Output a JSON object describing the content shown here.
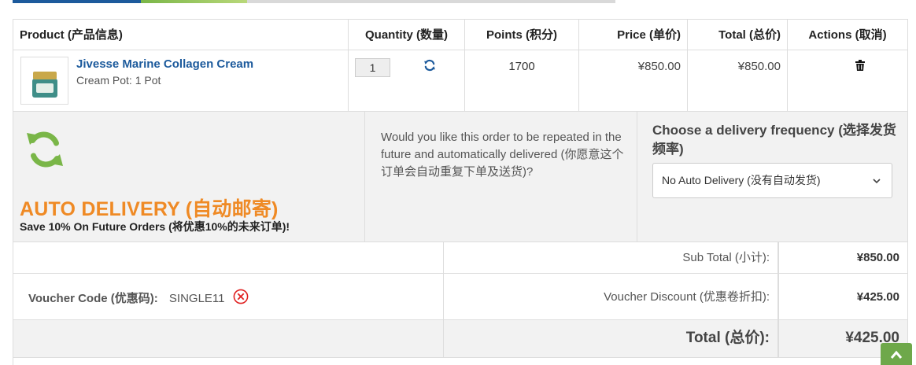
{
  "table": {
    "headers": {
      "product": "Product (产品信息)",
      "quantity": "Quantity (数量)",
      "points": "Points (积分)",
      "price": "Price (单价)",
      "total": "Total (总价)",
      "actions": "Actions (取消)"
    },
    "item": {
      "name": "Jivesse Marine Collagen Cream",
      "variant": "Cream Pot: 1 Pot",
      "quantity": "1",
      "points": "1700",
      "price": "¥850.00",
      "total": "¥850.00"
    }
  },
  "auto_delivery": {
    "title": "AUTO DELIVERY (自动邮寄)",
    "subtitle": "Save 10% On Future Orders (将优惠10%的未来订单)!",
    "question": "Would you like this order to be repeated in the future and automatically delivered (你愿意这个订单会自动重复下单及送货)?",
    "frequency_label": "Choose a delivery frequency (选择发货频率)",
    "frequency_selected": "No Auto Delivery (没有自动发货)"
  },
  "totals": {
    "subtotal_label": "Sub Total (小计):",
    "subtotal_value": "¥850.00",
    "voucher_code_label": "Voucher Code (优惠码):",
    "voucher_code_value": "SINGLE11",
    "voucher_discount_label": "Voucher Discount (优惠卷折扣):",
    "voucher_discount_value": "¥425.00",
    "total_label": "Total (总价):",
    "total_value": "¥425.00"
  },
  "colors": {
    "link_blue": "#1c5a9c",
    "auto_orange": "#ef8a25",
    "refresh_green": "#7ab648",
    "remove_red": "#e02020",
    "scroll_green": "#6ea84a"
  },
  "icons": {
    "refresh": "refresh-icon",
    "trash": "trash-icon",
    "auto_delivery": "auto-delivery-refresh-icon",
    "dropdown": "chevron-down-icon",
    "remove_voucher": "remove-voucher-icon",
    "scroll_top": "scroll-to-top-icon"
  }
}
